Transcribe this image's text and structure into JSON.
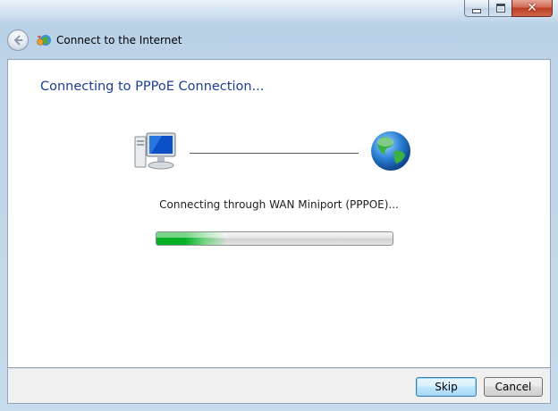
{
  "window": {
    "title": "Connect to the Internet",
    "caption_buttons": [
      "minimize-icon",
      "maximize-icon",
      "close-icon"
    ]
  },
  "navigation": {
    "back_icon": "back-arrow-icon",
    "app_icon": "network-connect-icon"
  },
  "main": {
    "heading": "Connecting to PPPoE Connection...",
    "source_icon": "computer-icon",
    "destination_icon": "globe-icon",
    "status": "Connecting through WAN Miniport (PPPOE)...",
    "progress_fraction": 0.3,
    "progress_color": "#06b025"
  },
  "footer": {
    "skip_label": "Skip",
    "cancel_label": "Cancel"
  },
  "colors": {
    "heading": "#1c3f95",
    "frame": "#bcd3e8",
    "close_button": "#c84d35"
  }
}
